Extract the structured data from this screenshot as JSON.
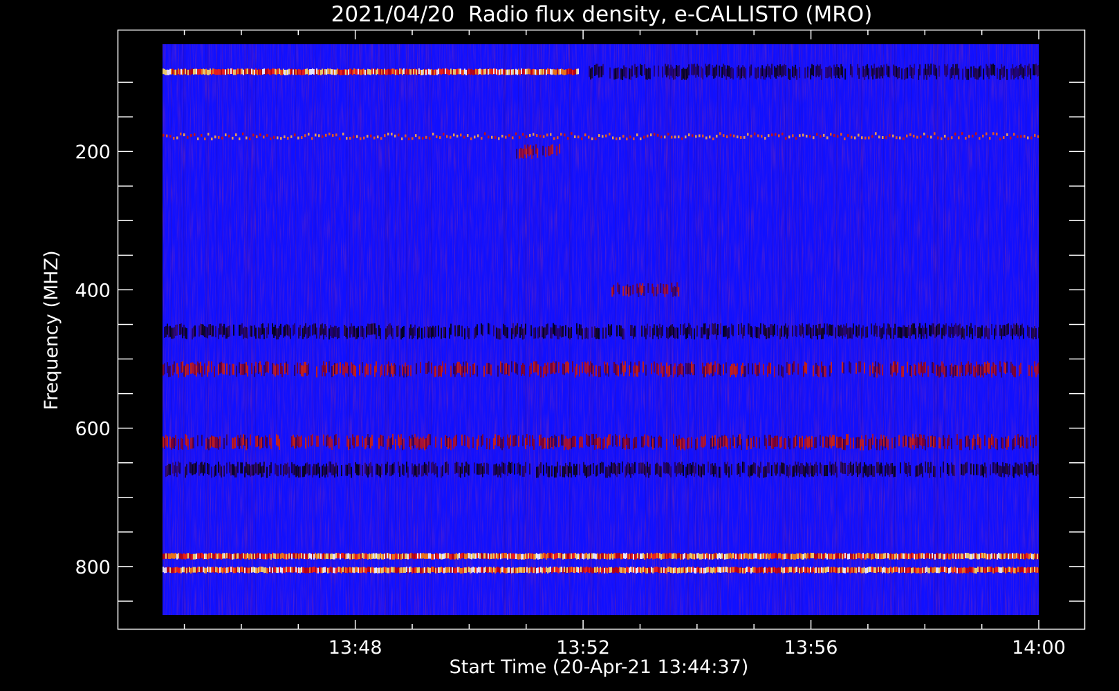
{
  "chart_data": {
    "type": "heatmap",
    "title": "2021/04/20  Radio flux density, e-CALLISTO (MRO)",
    "xlabel": "Start Time (20-Apr-21 13:44:37)",
    "ylabel": "Frequency (MHZ)",
    "x_unit": "time",
    "x_start": "13:44:37",
    "x_end": "14:00:00",
    "x_ticks": [
      "13:48",
      "13:52",
      "13:56",
      "14:00"
    ],
    "y_ticks": [
      200,
      400,
      600,
      800
    ],
    "y_range": [
      45,
      870
    ],
    "y_inverted": true,
    "colormap": "blue-red-yellow-white (low to high intensity)",
    "background_color": "#1010ff",
    "features": [
      {
        "kind": "bright band",
        "freq_mhz": 85,
        "time": [
          "13:44:37",
          "13:51:55"
        ],
        "level": "high"
      },
      {
        "kind": "dark band",
        "freq_mhz": 85,
        "time": [
          "13:52:00",
          "14:00:00"
        ],
        "level": "low"
      },
      {
        "kind": "dotted interference line",
        "freq_mhz": 178,
        "time": [
          "13:44:37",
          "14:00:00"
        ],
        "level": "medium-high"
      },
      {
        "kind": "emission patch",
        "freq_mhz": 200,
        "time": [
          "13:50:45",
          "13:51:40"
        ],
        "level": "medium"
      },
      {
        "kind": "emission patch",
        "freq_mhz": 400,
        "time": [
          "13:52:30",
          "13:53:40"
        ],
        "level": "medium"
      },
      {
        "kind": "dark band",
        "freq_mhz": 460,
        "time": [
          "13:44:37",
          "14:00:00"
        ],
        "level": "low"
      },
      {
        "kind": "mixed band",
        "freq_mhz": 515,
        "time": [
          "13:44:37",
          "14:00:00"
        ],
        "level": "medium"
      },
      {
        "kind": "mixed band",
        "freq_mhz": 620,
        "time": [
          "13:44:37",
          "14:00:00"
        ],
        "level": "medium"
      },
      {
        "kind": "dark band",
        "freq_mhz": 660,
        "time": [
          "13:44:37",
          "14:00:00"
        ],
        "level": "low"
      },
      {
        "kind": "bright band",
        "freq_mhz": 785,
        "time": [
          "13:44:37",
          "14:00:00"
        ],
        "level": "high"
      },
      {
        "kind": "bright band",
        "freq_mhz": 805,
        "time": [
          "13:44:37",
          "14:00:00"
        ],
        "level": "high"
      }
    ],
    "grid": false,
    "legend": "none"
  }
}
